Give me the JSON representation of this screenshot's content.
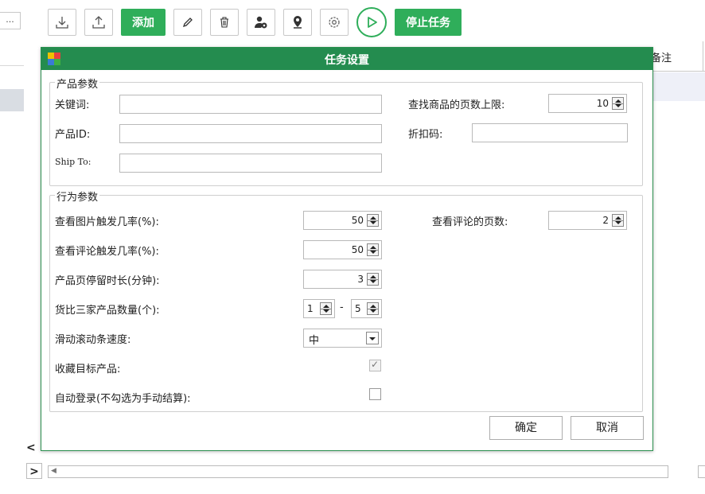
{
  "app": {
    "left_more_label": "...",
    "toolbar": {
      "buttons": [
        {
          "name": "download-button",
          "icon": "download-icon"
        },
        {
          "name": "upload-button",
          "icon": "upload-icon"
        }
      ],
      "add_label": "添加",
      "tool_buttons": [
        {
          "name": "edit-button",
          "icon": "pencil-icon"
        },
        {
          "name": "delete-button",
          "icon": "trash-icon"
        },
        {
          "name": "user-settings-button",
          "icon": "user-gear-icon"
        },
        {
          "name": "location-button",
          "icon": "location-pin-icon"
        },
        {
          "name": "settings-button",
          "icon": "gear-icon"
        }
      ],
      "play_icon": "play-icon",
      "stop_label": "停止任务",
      "accent": "#2fae5a"
    },
    "grid": {
      "column_header": "备注"
    },
    "nav": {
      "left": "<",
      "right": ">"
    },
    "hscroll_arrow": "◀"
  },
  "dialog": {
    "title": "任务设置",
    "title_bar_color": "#248c4f",
    "product_group": {
      "title": "产品参数",
      "keyword_label": "关键词:",
      "keyword_value": "",
      "product_id_label": "产品ID:",
      "product_id_value": "",
      "ship_to_label": "Ship To:",
      "ship_to_value": "",
      "max_pages_label": "查找商品的页数上限:",
      "max_pages_value": "10",
      "discount_label": "折扣码:",
      "discount_value": ""
    },
    "behavior_group": {
      "title": "行为参数",
      "view_image_label": "查看图片触发几率(%):",
      "view_image_value": "50",
      "view_review_pages_label": "查看评论的页数:",
      "view_review_pages_value": "2",
      "view_review_label": "查看评论触发几率(%):",
      "view_review_value": "50",
      "stay_time_label": "产品页停留时长(分钟):",
      "stay_time_value": "3",
      "compare_label": "货比三家产品数量(个):",
      "compare_min": "1",
      "compare_dash": "-",
      "compare_max": "5",
      "scroll_speed_label": "滑动滚动条速度:",
      "scroll_speed_value": "中",
      "favorite_label": "收藏目标产品:",
      "favorite_checked": true,
      "auto_login_label": "自动登录(不勾选为手动结算):",
      "auto_login_checked": false
    },
    "ok_label": "确定",
    "cancel_label": "取消"
  }
}
